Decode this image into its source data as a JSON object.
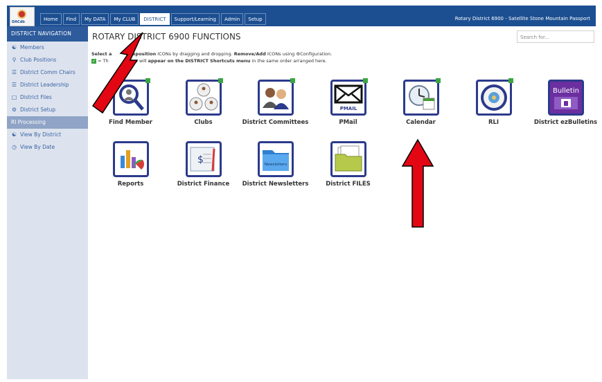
{
  "topbar": {
    "tabs": [
      {
        "label": "Home"
      },
      {
        "label": "Find"
      },
      {
        "label": "My DATA"
      },
      {
        "label": "My CLUB"
      },
      {
        "label": "DISTRICT"
      },
      {
        "label": "Support/Learning"
      },
      {
        "label": "Admin"
      },
      {
        "label": "Setup"
      }
    ],
    "right_title": "Rotary District 6900 - Satellite Stone Mountain Passport"
  },
  "sidebar": {
    "header": "DISTRICT NAVIGATION",
    "items": [
      {
        "label": "Members"
      },
      {
        "label": "Club Positions"
      },
      {
        "label": "District Comm Chairs"
      },
      {
        "label": "District Leadership"
      },
      {
        "label": "District Files"
      },
      {
        "label": "District Setup"
      },
      {
        "label": "RI Processing"
      },
      {
        "label": "View By District"
      },
      {
        "label": "View By Date"
      }
    ]
  },
  "main": {
    "title": "ROTARY DISTRICT 6900 FUNCTIONS",
    "search_placeholder": "Search for...",
    "instruction1_a": "Select a",
    "instruction1_b": "Reposition",
    "instruction1_c": "ICONs by dragging and dropping.",
    "instruction1_d": "Remove/Add",
    "instruction1_e": "ICONs using",
    "instruction1_f": "Configuration.",
    "instruction2_a": "= Th",
    "instruction2_b": "ctions will",
    "instruction2_c": "appear on the DISTRICT Shortcuts menu",
    "instruction2_d": "in the same order arranged here.",
    "tiles": [
      {
        "label": "Find Member"
      },
      {
        "label": "Clubs"
      },
      {
        "label": "District Committees"
      },
      {
        "label": "PMail"
      },
      {
        "label": "Calendar"
      },
      {
        "label": "RLI"
      },
      {
        "label": "District ezBulletins"
      },
      {
        "label": "Reports"
      },
      {
        "label": "District Finance"
      },
      {
        "label": "District Newsletters"
      },
      {
        "label": "District FILES"
      }
    ],
    "pmail_icon_text": "PMAIL",
    "bulletin_icon_text": "Bulletin",
    "newsletters_icon_text": "Newsletters"
  },
  "colors": {
    "topbar": "#1c4f91",
    "sidebar": "#dde3ee",
    "tile_border": "#2b3a8c",
    "arrow": "#e30613"
  }
}
